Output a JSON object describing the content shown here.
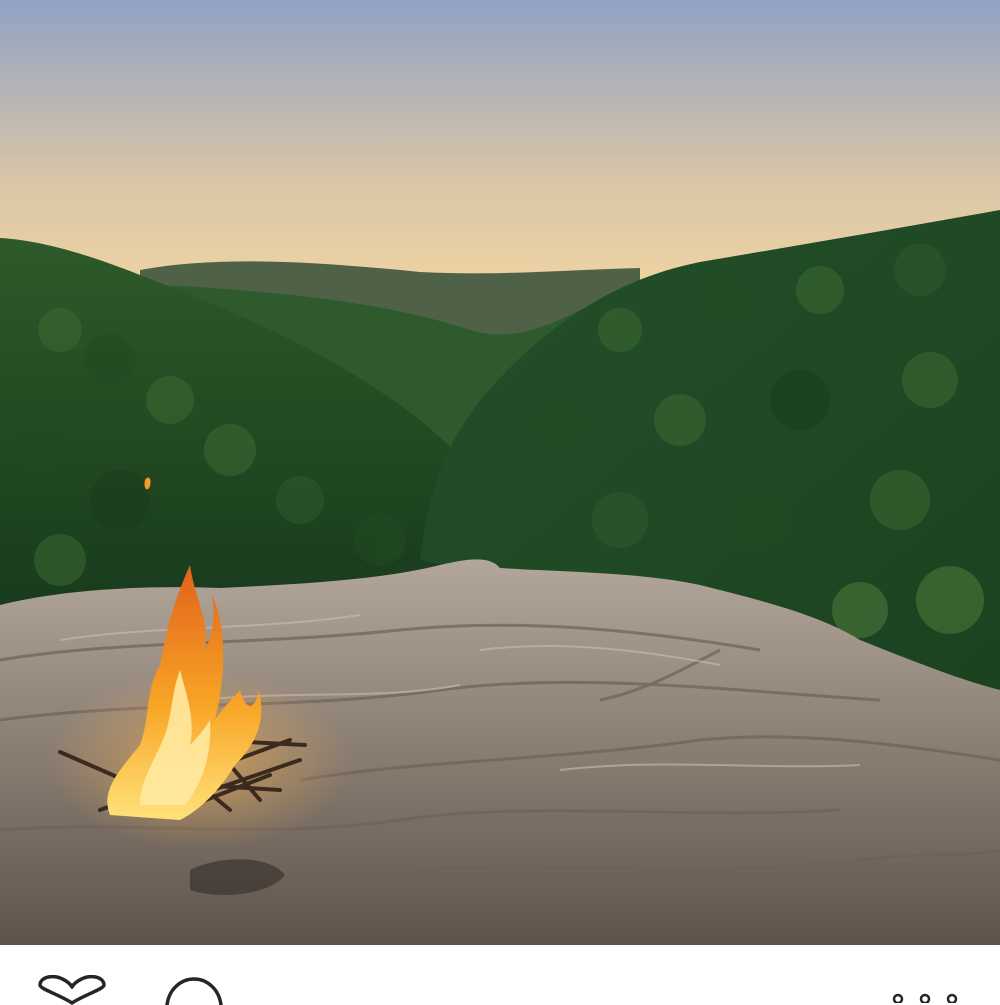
{
  "post": {
    "image": {
      "subject": "campfire-on-rock-ledge",
      "colors": {
        "sky_top": "#8fa3c4",
        "sky_mid": "#d9c6a8",
        "sky_horizon": "#f7d9a0",
        "ridge_far": "#4f6248",
        "forest_dark": "#173a1c",
        "forest_mid": "#2e5a2a",
        "forest_light": "#4c7d3a",
        "rock_base": "#8a7d72",
        "rock_light": "#b3a69a",
        "rock_dark": "#5e544c",
        "flame_outer": "#f08a1c",
        "flame_inner": "#ffe27a"
      }
    },
    "actions": {
      "like_icon": "heart-outline",
      "comment_icon": "speech-bubble-outline",
      "more_icon": "ellipsis"
    }
  }
}
